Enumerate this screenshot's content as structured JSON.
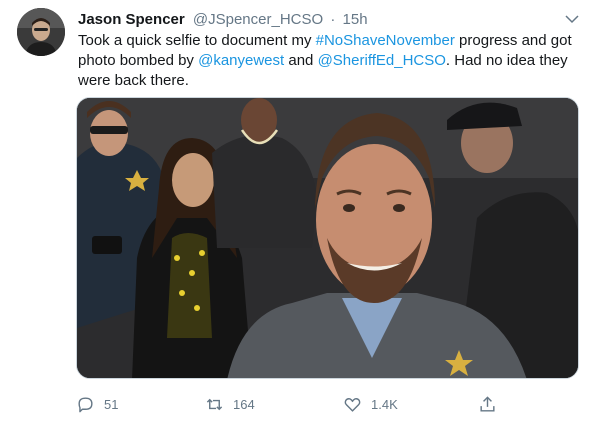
{
  "tweet": {
    "author_name": "Jason Spencer",
    "author_handle": "@JSpencer_HCSO",
    "separator": "·",
    "time": "15h",
    "text": {
      "p1": "Took a quick selfie to document my ",
      "hashtag": "#NoShaveNovember",
      "p2": " progress and got photo bombed by ",
      "mention1": "@kanyewest",
      "p3": " and ",
      "mention2": "@SheriffEd_HCSO",
      "p4": ". Had no idea they were back there."
    }
  },
  "actions": {
    "replies": "51",
    "retweets": "164",
    "likes": "1.4K"
  },
  "icons": {
    "menu": "chevron-down-icon",
    "reply": "reply-icon",
    "retweet": "retweet-icon",
    "like": "heart-icon",
    "share": "share-icon"
  },
  "colors": {
    "link": "#1b95e0",
    "secondary_text": "#657786",
    "primary_text": "#14171a"
  }
}
